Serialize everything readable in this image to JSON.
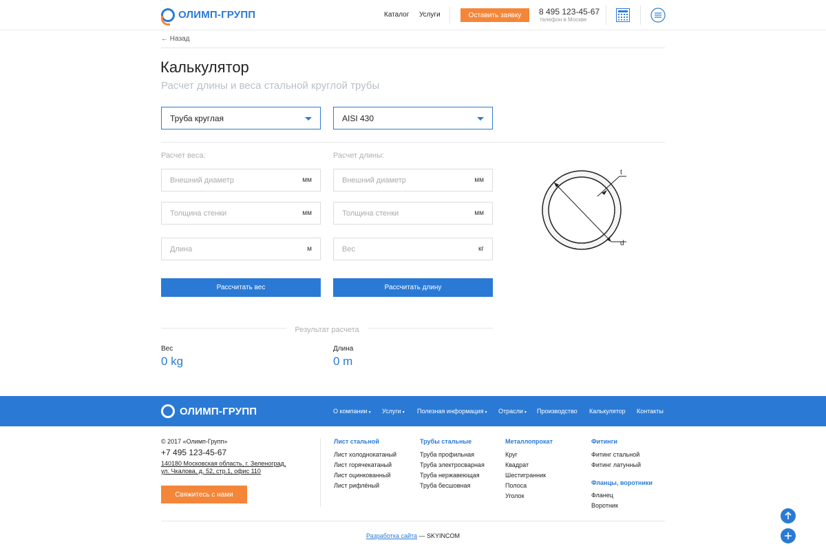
{
  "header": {
    "logo_text": "ОЛИМП-ГРУПП",
    "nav": [
      "Каталог",
      "Услуги"
    ],
    "cta": "Оставить заявку",
    "phone": "8 495 123-45-67",
    "phone_sub": "телефон в Москве"
  },
  "page": {
    "back": "Назад",
    "title": "Калькулятор",
    "subtitle": "Расчет длины и веса стальной круглой трубы",
    "select_type": "Труба круглая",
    "select_grade": "AISI 430"
  },
  "weight_calc": {
    "label": "Расчет веса:",
    "outer_diameter": "Внешний диаметр",
    "outer_diameter_unit": "мм",
    "wall": "Толщина стенки",
    "wall_unit": "мм",
    "length": "Длина",
    "length_unit": "м",
    "button": "Рассчитать вес"
  },
  "length_calc": {
    "label": "Расчет длины:",
    "outer_diameter": "Внешний диаметр",
    "outer_diameter_unit": "мм",
    "wall": "Толщина стенки",
    "wall_unit": "мм",
    "weight": "Вес",
    "weight_unit": "кг",
    "button": "Рассчитать длину"
  },
  "diagram": {
    "t_label": "t",
    "d_label": "d"
  },
  "result": {
    "title": "Результат расчета",
    "weight_label": "Вес",
    "weight_value": "0 kg",
    "length_label": "Длина",
    "length_value": "0 m"
  },
  "footer": {
    "logo_text": "ОЛИМП-ГРУПП",
    "nav": [
      "О компании",
      "Услуги",
      "Полезная информация",
      "Отрасли",
      "Производство",
      "Калькулятор",
      "Контакты"
    ],
    "copyright": "© 2017 «Олимп-Групп»",
    "phone": "+7 495 123-45-67",
    "address1": "140180 Московская область, г. Зеленоград,",
    "address2": "ул. Чкалова, д. 52, стр.1, офис 110",
    "contact_button": "Свяжитесь с нами",
    "col1": {
      "head": "Лист стальной",
      "items": [
        "Лист холоднокатаный",
        "Лист горячекатаный",
        "Лист оцинкованный",
        "Лист рифлёный"
      ]
    },
    "col2": {
      "head": "Трубы стальные",
      "items": [
        "Труба профильная",
        "Труба электросварная",
        "Труба нержавеющая",
        "Труба бесшовная"
      ]
    },
    "col3": {
      "head": "Металлопрокат",
      "items": [
        "Круг",
        "Квадрат",
        "Шестигранник",
        "Полоса",
        "Уголок"
      ]
    },
    "col4": {
      "head": "Фитинги",
      "items": [
        "Фитинг стальной",
        "Фитинг латунный"
      ]
    },
    "col4b": {
      "head": "Фланцы, воротники",
      "items": [
        "Фланец",
        "Воротник"
      ]
    },
    "credit_link": "Разработка сайта",
    "credit_rest": " — SKYINCOM"
  },
  "colors": {
    "accent": "#2a7ad5",
    "cta": "#f4863a"
  }
}
